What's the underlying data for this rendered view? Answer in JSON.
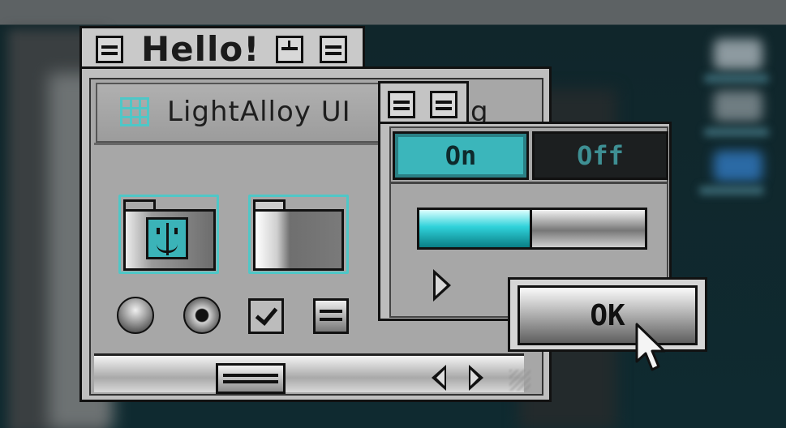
{
  "window": {
    "title": "Hello!"
  },
  "panel": {
    "header_text": "LightAlloy UI",
    "header_icon": "grid-icon",
    "header_text_clipped_suffix": "g"
  },
  "toggle": {
    "on_label": "On",
    "off_label": "Off",
    "selected": "On"
  },
  "progress": {
    "value_fraction": 0.5
  },
  "dialog": {
    "ok_label": "OK"
  },
  "colors": {
    "accent": "#3bb6bb",
    "frame": "#111111",
    "chrome": "#bdbdbd"
  },
  "icons": [
    "grid-icon",
    "finder-folder-icon",
    "folder-icon",
    "sphere-button-icon",
    "radio-selected-icon",
    "checkbox-icon",
    "menu-lines-icon",
    "play-icon",
    "arrow-left-icon",
    "arrow-right-icon",
    "pointer-cursor-icon"
  ]
}
